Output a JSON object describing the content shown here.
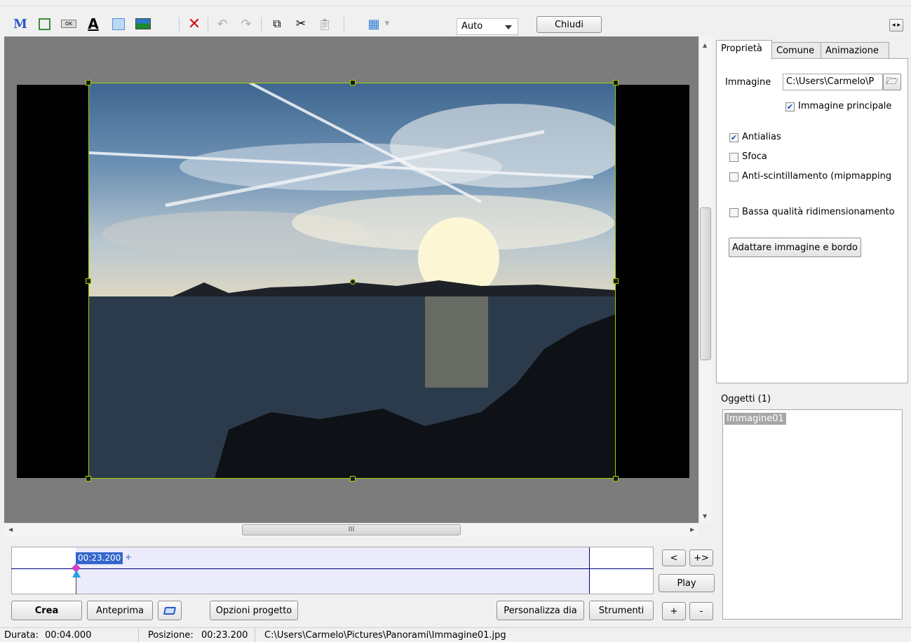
{
  "toolbar": {
    "icons": [
      "text-m-icon",
      "frame-icon",
      "ok-button-icon",
      "text-a-icon",
      "rectangle-icon",
      "image-icon",
      "delete-icon",
      "undo-icon",
      "redo-icon",
      "copy-icon",
      "cut-icon",
      "paste-icon",
      "grid-icon"
    ],
    "zoom_value": "Auto",
    "close_label": "Chiudi"
  },
  "canvas": {
    "hscroll_grip": "III"
  },
  "timeline": {
    "time_label": "00:23.200",
    "marker": "+"
  },
  "timeline_controls": {
    "prev_label": "<",
    "next_label": "+>",
    "play_label": "Play",
    "plus_label": "+",
    "minus_label": "-"
  },
  "bottom_buttons": {
    "crea": "Crea",
    "anteprima": "Anteprima",
    "opzioni": "Opzioni progetto",
    "personalizza": "Personalizza dia",
    "strumenti": "Strumenti"
  },
  "panel": {
    "tabs": [
      "Proprietà",
      "Comune",
      "Animazione"
    ],
    "image_label": "Immagine",
    "image_path": "C:\\Users\\Carmelo\\P",
    "main_image_label": "Immagine principale",
    "antialias_label": "Antialias",
    "sfoca_label": "Sfoca",
    "mipmap_label": "Anti-scintillamento (mipmapping",
    "low_quality_label": "Bassa qualità ridimensionamento",
    "fit_button": "Adattare immagine e bordo",
    "checks": {
      "main_image": true,
      "antialias": true,
      "sfoca": false,
      "mipmap": false,
      "low_quality": false
    }
  },
  "objects": {
    "title": "Oggetti (1)",
    "items": [
      "Immagine01"
    ]
  },
  "status": {
    "durata_label": "Durata:",
    "durata_value": "00:04.000",
    "posizione_label": "Posizione:",
    "posizione_value": "00:23.200",
    "path": "C:\\Users\\Carmelo\\Pictures\\Panorami\\Immagine01.jpg"
  },
  "colors": {
    "accent": "#3366cc",
    "selection": "#9fd000",
    "delete": "#d01010"
  }
}
